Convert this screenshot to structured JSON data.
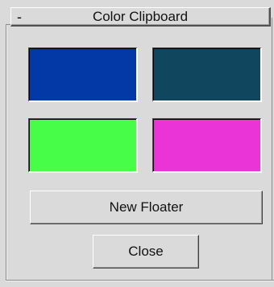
{
  "rollout": {
    "toggle_symbol": "-",
    "title": "Color Clipboard"
  },
  "swatches": [
    {
      "color": "#0239a6"
    },
    {
      "color": "#11475e"
    },
    {
      "color": "#48fd47"
    },
    {
      "color": "#ea34d8"
    }
  ],
  "buttons": {
    "new_floater": "New Floater",
    "close": "Close"
  }
}
